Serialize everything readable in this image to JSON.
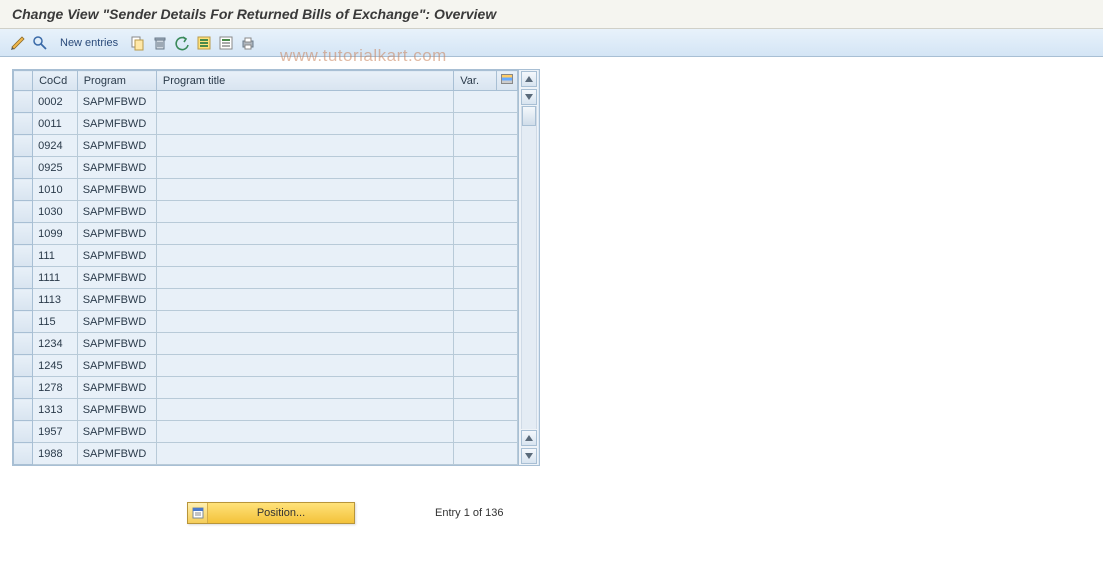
{
  "title": "Change View \"Sender Details For Returned Bills of Exchange\": Overview",
  "toolbar": {
    "new_entries": "New entries"
  },
  "watermark": "www.tutorialkart.com",
  "table": {
    "headers": {
      "cocd": "CoCd",
      "program": "Program",
      "title": "Program title",
      "var": "Var."
    },
    "rows": [
      {
        "cocd": "0002",
        "program": "SAPMFBWD",
        "title": "",
        "var": ""
      },
      {
        "cocd": "0011",
        "program": "SAPMFBWD",
        "title": "",
        "var": ""
      },
      {
        "cocd": "0924",
        "program": "SAPMFBWD",
        "title": "",
        "var": ""
      },
      {
        "cocd": "0925",
        "program": "SAPMFBWD",
        "title": "",
        "var": ""
      },
      {
        "cocd": "1010",
        "program": "SAPMFBWD",
        "title": "",
        "var": ""
      },
      {
        "cocd": "1030",
        "program": "SAPMFBWD",
        "title": "",
        "var": ""
      },
      {
        "cocd": "1099",
        "program": "SAPMFBWD",
        "title": "",
        "var": ""
      },
      {
        "cocd": "111",
        "program": "SAPMFBWD",
        "title": "",
        "var": ""
      },
      {
        "cocd": "1111",
        "program": "SAPMFBWD",
        "title": "",
        "var": ""
      },
      {
        "cocd": "1113",
        "program": "SAPMFBWD",
        "title": "",
        "var": ""
      },
      {
        "cocd": "115",
        "program": "SAPMFBWD",
        "title": "",
        "var": ""
      },
      {
        "cocd": "1234",
        "program": "SAPMFBWD",
        "title": "",
        "var": ""
      },
      {
        "cocd": "1245",
        "program": "SAPMFBWD",
        "title": "",
        "var": ""
      },
      {
        "cocd": "1278",
        "program": "SAPMFBWD",
        "title": "",
        "var": ""
      },
      {
        "cocd": "1313",
        "program": "SAPMFBWD",
        "title": "",
        "var": ""
      },
      {
        "cocd": "1957",
        "program": "SAPMFBWD",
        "title": "",
        "var": ""
      },
      {
        "cocd": "1988",
        "program": "SAPMFBWD",
        "title": "",
        "var": ""
      }
    ]
  },
  "footer": {
    "position_label": "Position...",
    "entry_info": "Entry 1 of 136"
  }
}
